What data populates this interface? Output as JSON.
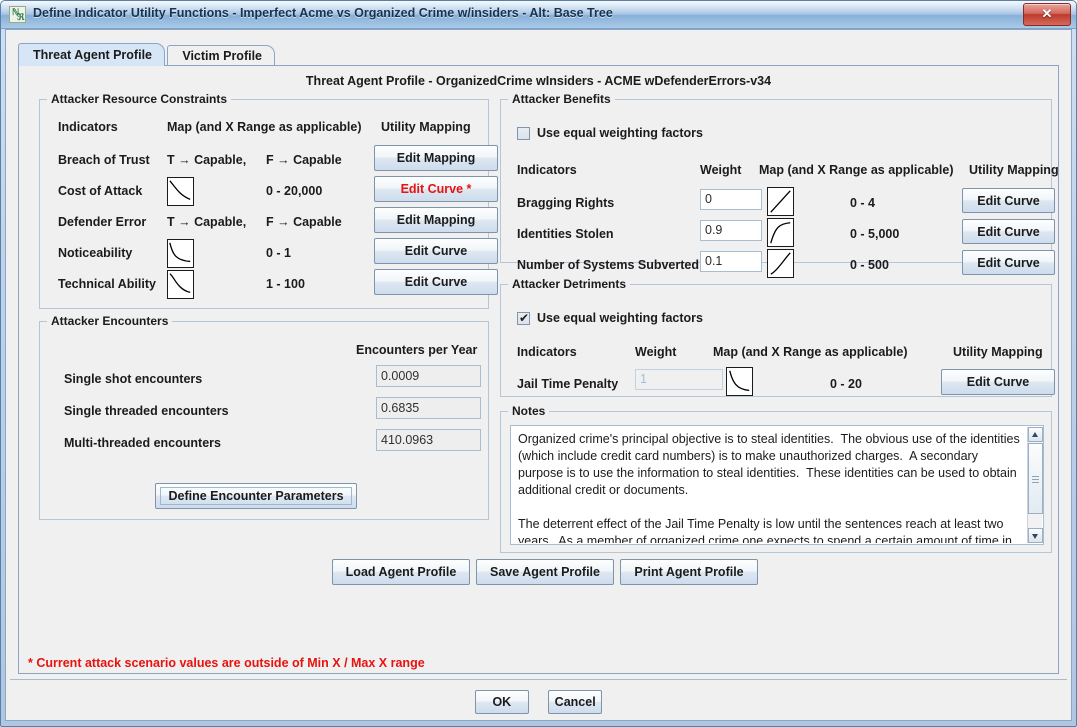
{
  "window": {
    "title": "Define Indicator Utility Functions - Imperfect Acme vs Organized Crime w/insiders - Alt: Base Tree",
    "close_label": "✕",
    "app_icon": "application-icon"
  },
  "tabs": [
    {
      "label": "Threat Agent Profile",
      "active": true
    },
    {
      "label": "Victim Profile",
      "active": false
    }
  ],
  "panel_title": "Threat Agent Profile - OrganizedCrime wInsiders - ACME wDefenderErrors-v34",
  "resource_constraints": {
    "legend": "Attacker Resource Constraints",
    "headers": {
      "indicators": "Indicators",
      "map": "Map (and X Range as applicable)",
      "utility": "Utility Mapping"
    },
    "rows": [
      {
        "indicator": "Breach of Trust",
        "map_true": "T → Capable,",
        "map_false": "F → Capable",
        "curve": null,
        "range": "",
        "button": "Edit Mapping",
        "alert": false
      },
      {
        "indicator": "Cost of Attack",
        "map_true": "",
        "map_false": "",
        "curve": "decreasing-convex",
        "range": "0 - 20,000",
        "button": "Edit Curve *",
        "alert": true
      },
      {
        "indicator": "Defender Error",
        "map_true": "T → Capable,",
        "map_false": "F → Capable",
        "curve": null,
        "range": "",
        "button": "Edit Mapping",
        "alert": false
      },
      {
        "indicator": "Noticeability",
        "map_true": "",
        "map_false": "",
        "curve": "decreasing-steep",
        "range": "0 - 1",
        "button": "Edit Curve",
        "alert": false
      },
      {
        "indicator": "Technical Ability",
        "map_true": "",
        "map_false": "",
        "curve": "decreasing-sigmoid",
        "range": "1 - 100",
        "button": "Edit Curve",
        "alert": false
      }
    ]
  },
  "encounters": {
    "legend": "Attacker Encounters",
    "column_header": "Encounters per Year",
    "rows": [
      {
        "label": "Single shot encounters",
        "value": "0.0009"
      },
      {
        "label": "Single threaded encounters",
        "value": "0.6835"
      },
      {
        "label": "Multi-threaded encounters",
        "value": "410.0963"
      }
    ],
    "define_button": "Define Encounter Parameters"
  },
  "benefits": {
    "legend": "Attacker Benefits",
    "equal_weighting_label": "Use equal weighting factors",
    "equal_weighting_checked": false,
    "headers": {
      "indicators": "Indicators",
      "weight": "Weight",
      "map": "Map (and X Range as applicable)",
      "utility": "Utility Mapping"
    },
    "rows": [
      {
        "indicator": "Bragging Rights",
        "weight": "0",
        "curve": "increasing-linear",
        "range": "0 - 4",
        "button": "Edit Curve"
      },
      {
        "indicator": "Identities Stolen",
        "weight": "0.9",
        "curve": "increasing-concave",
        "range": "0 - 5,000",
        "button": "Edit Curve"
      },
      {
        "indicator": "Number of Systems Subverted",
        "weight": "0.1",
        "curve": "increasing-convex",
        "range": "0 - 500",
        "button": "Edit Curve"
      }
    ]
  },
  "detriments": {
    "legend": "Attacker Detriments",
    "equal_weighting_label": "Use equal weighting factors",
    "equal_weighting_checked": true,
    "headers": {
      "indicators": "Indicators",
      "weight": "Weight",
      "map": "Map (and X Range as applicable)",
      "utility": "Utility Mapping"
    },
    "rows": [
      {
        "indicator": "Jail Time Penalty",
        "weight": "1",
        "weight_disabled": true,
        "curve": "decreasing-convex",
        "range": "0 - 20",
        "button": "Edit Curve"
      }
    ]
  },
  "notes": {
    "legend": "Notes",
    "text": "Organized crime's principal objective is to steal identities.  The obvious use of the identities (which include credit card numbers) is to make unauthorized charges.  A secondary purpose is to use the information to steal identities.  These identities can be used to obtain additional credit or documents.\n\nThe deterrent effect of the Jail Time Penalty is low until the sentences reach at least two years.  As a member of organized crime one expects to spend a certain amount of time in the slammer and the rewards are assumed to be sufficient  to outweigh the penalties."
  },
  "profile_buttons": [
    {
      "label": "Load Agent Profile"
    },
    {
      "label": "Save Agent Profile"
    },
    {
      "label": "Print Agent Profile"
    }
  ],
  "warning": "* Current attack scenario values are outside of Min X / Max X range",
  "footer_buttons": [
    {
      "label": "OK"
    },
    {
      "label": "Cancel"
    }
  ]
}
